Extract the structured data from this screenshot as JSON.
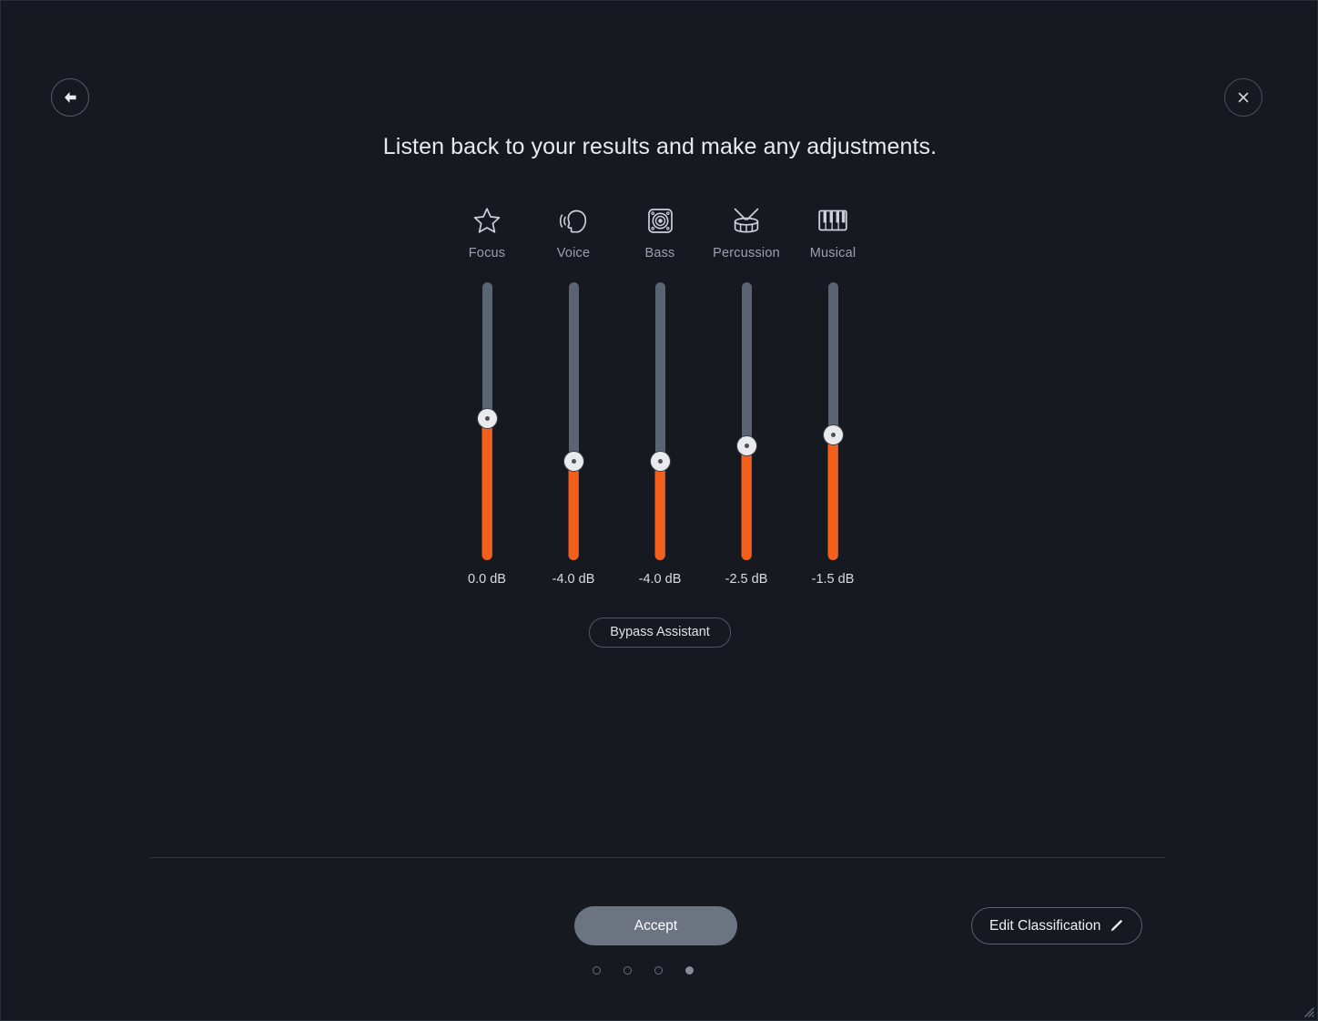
{
  "window": {
    "background_color": "#16191f",
    "accent_color": "#f4601c"
  },
  "header": {
    "back_button_label": "Back",
    "back_icon": "arrow-left-icon",
    "close_button_label": "Close",
    "close_icon": "close-x-icon",
    "title": "Listen back to your results and make any adjustments."
  },
  "mixer": {
    "channels": [
      {
        "name": "Focus",
        "icon": "star-icon",
        "value_label": "0.0 dB",
        "value": 0.0,
        "thumb_pct": 49.0
      },
      {
        "name": "Voice",
        "icon": "voice-head-icon",
        "value_label": "-4.0 dB",
        "value": -4.0,
        "thumb_pct": 64.3
      },
      {
        "name": "Bass",
        "icon": "speaker-icon",
        "value_label": "-4.0 dB",
        "value": -4.0,
        "thumb_pct": 64.3
      },
      {
        "name": "Percussion",
        "icon": "drum-icon",
        "value_label": "-2.5 dB",
        "value": -2.5,
        "thumb_pct": 59.0
      },
      {
        "name": "Musical",
        "icon": "piano-icon",
        "value_label": "-1.5 dB",
        "value": -1.5,
        "thumb_pct": 55.0
      }
    ],
    "bypass_label": "Bypass Assistant"
  },
  "footer": {
    "accept_label": "Accept",
    "edit_classification_label": "Edit Classification",
    "edit_icon": "pencil-icon",
    "pagination": {
      "total": 4,
      "active_index": 3
    }
  },
  "resize_grip_icon": "resize-grip-icon"
}
